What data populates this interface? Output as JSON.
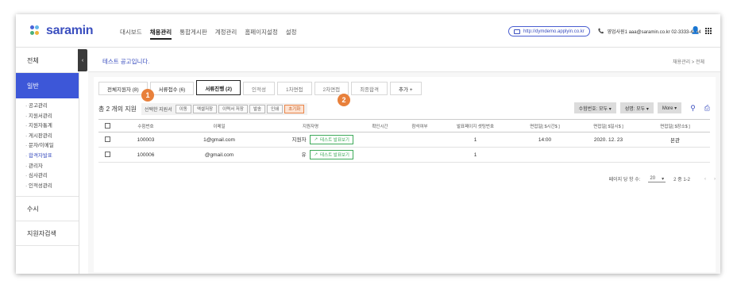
{
  "header": {
    "logo": "saramin",
    "nav": [
      "대시보드",
      "채용관리",
      "통합게시판",
      "계정관리",
      "홈페이지설정",
      "설정"
    ],
    "active_nav": "채용관리",
    "url": "http://dymdemo.applyin.co.kr",
    "contact": "영업사원1 aaa@saramin.co.kr 02-3333-4444"
  },
  "sidebar": {
    "items": [
      "전체",
      "일반",
      "수시",
      "지원자검색"
    ],
    "sub_items": [
      "· 공고관리",
      "· 지원서관리",
      "· 지원자통계",
      "· 게시판관리",
      "· 문자/이메일",
      "· 합격자발표",
      "· 관리자",
      "· 심사관리",
      "· 인적성관리"
    ],
    "current_sub": "· 합격자발표"
  },
  "page": {
    "title": "테스트 공고입니다.",
    "breadcrumb": "채용관리 > 전체"
  },
  "tabs": [
    "전체지원자 (8)",
    "서류접수 (6)",
    "서류진행 (2)",
    "인적성",
    "1차면접",
    "2차면접",
    "최종합격",
    "추가 +"
  ],
  "actions": {
    "total": "총 2 개의 지원",
    "selected_label": "선택한 지원서",
    "buttons": [
      "이동",
      "엑셀저장",
      "이력서 저장",
      "발송",
      "인쇄",
      "초기화"
    ],
    "sort1": "수험번호: 모두 ▾",
    "sort2": "성명: 모두 ▾",
    "more": "More ▾"
  },
  "badges": [
    "1",
    "2"
  ],
  "table": {
    "headers": [
      "",
      "수험번호",
      "이메일",
      "지원자명",
      "확인시간",
      "참석여부",
      "발표페이지 셋팅번호",
      "면접일[ $시간$ ]",
      "면접일[ $일시$ ]",
      "면접일[ $장소$ ]"
    ],
    "view_label": "테스트 발표보기",
    "rows": [
      [
        "100003",
        "1@gmail.com",
        "지원자",
        "",
        "",
        "1",
        "14:00",
        "2020. 12. 23",
        "본관"
      ],
      [
        "100006",
        "@gmail.com",
        "유",
        "",
        "",
        "1",
        "",
        "",
        ""
      ]
    ]
  },
  "pager": {
    "label": "페이지 당 항 수:",
    "size": "20",
    "range": "2 중 1-2"
  },
  "colors": {
    "brand": "#3b4fbf",
    "sidebar_active": "#3d57d8",
    "badge": "#e8803b",
    "view_green": "#3eaa5a"
  }
}
